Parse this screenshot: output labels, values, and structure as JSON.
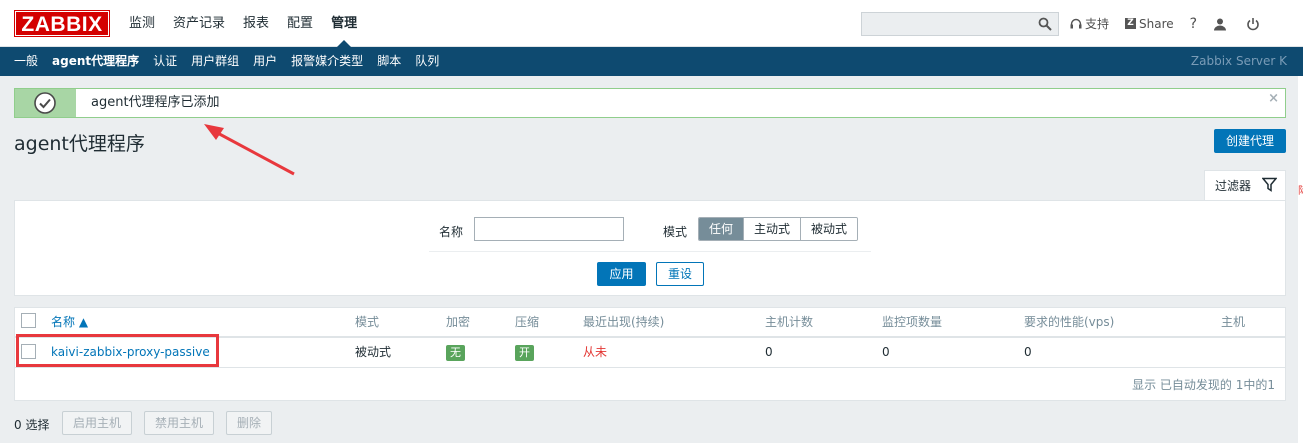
{
  "header": {
    "logo": "ZABBIX",
    "menu": [
      "监测",
      "资产记录",
      "报表",
      "配置",
      "管理"
    ],
    "active_menu": 4,
    "search_placeholder": "",
    "support_label": "支持",
    "share_label": "Share",
    "help_label": "?",
    "colors": {
      "logo_bg": "#d40000",
      "submenu_bg": "#0e4a70",
      "accent": "#0275b8"
    }
  },
  "submenu": {
    "items": [
      "一般",
      "agent代理程序",
      "认证",
      "用户群组",
      "用户",
      "报警媒介类型",
      "脚本",
      "队列"
    ],
    "active": 1,
    "server_name": "Zabbix Server K"
  },
  "notice": {
    "message": "agent代理程序已添加",
    "close": "×",
    "icon": "check-circle-icon"
  },
  "page": {
    "title": "agent代理程序",
    "create_button": "创建代理"
  },
  "filter": {
    "tab_label": "过滤器",
    "name_label": "名称",
    "name_value": "",
    "mode_label": "模式",
    "mode_options": [
      "任何",
      "主动式",
      "被动式"
    ],
    "mode_selected": 0,
    "apply": "应用",
    "reset": "重设"
  },
  "table": {
    "columns": [
      "名称 ▲",
      "模式",
      "加密",
      "压缩",
      "最近出现(持续)",
      "主机计数",
      "监控项数量",
      "要求的性能(vps)",
      "主机"
    ],
    "rows": [
      {
        "name": "kaivi-zabbix-proxy-passive",
        "mode": "被动式",
        "encryption": "无",
        "compression": "开",
        "last_seen": "从未",
        "host_count": "0",
        "item_count": "0",
        "required_performance": "0",
        "hosts": ""
      }
    ],
    "footer": "显示 已自动发现的 1中的1"
  },
  "actions": {
    "selected_count": "0 选择",
    "enable": "启用主机",
    "disable": "禁用主机",
    "delete": "删除"
  },
  "edge": {
    "right_mark": "际"
  }
}
